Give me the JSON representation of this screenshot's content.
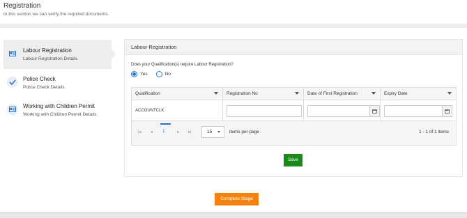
{
  "page": {
    "title": "Registration",
    "subtitle": "In this section we can verify the required documents."
  },
  "sidebar": {
    "items": [
      {
        "label": "Labour Registration",
        "sub": "Labour Registration Details",
        "icon": "id-card-icon"
      },
      {
        "label": "Police Check",
        "sub": "Police Check Details",
        "icon": "checkmark-icon"
      },
      {
        "label": "Working with Children Permit",
        "sub": "Working with Children Permit Details",
        "icon": "id-card-icon"
      }
    ]
  },
  "panel": {
    "title": "Labour Registration",
    "question": "Does your Qualification(s) require Labour Registration?",
    "options": {
      "yes": "Yes",
      "no": "No",
      "selected": "Yes"
    }
  },
  "grid": {
    "columns": [
      "Qualification",
      "Registration No",
      "Date of First Registration",
      "Expiry Date"
    ],
    "rows": [
      {
        "qualification": "ACCOUNTCLK",
        "registration_no": "",
        "date_first_registration": "",
        "expiry_date": ""
      }
    ],
    "pager": {
      "current_page": "1",
      "page_size": "15",
      "page_size_label": "items per page",
      "info": "1 - 1 of 1 items"
    }
  },
  "buttons": {
    "save": "Save",
    "complete": "Complete Stage"
  },
  "colors": {
    "save": "#1a8a1a",
    "complete": "#f5820c",
    "accent": "#2b74c7"
  }
}
